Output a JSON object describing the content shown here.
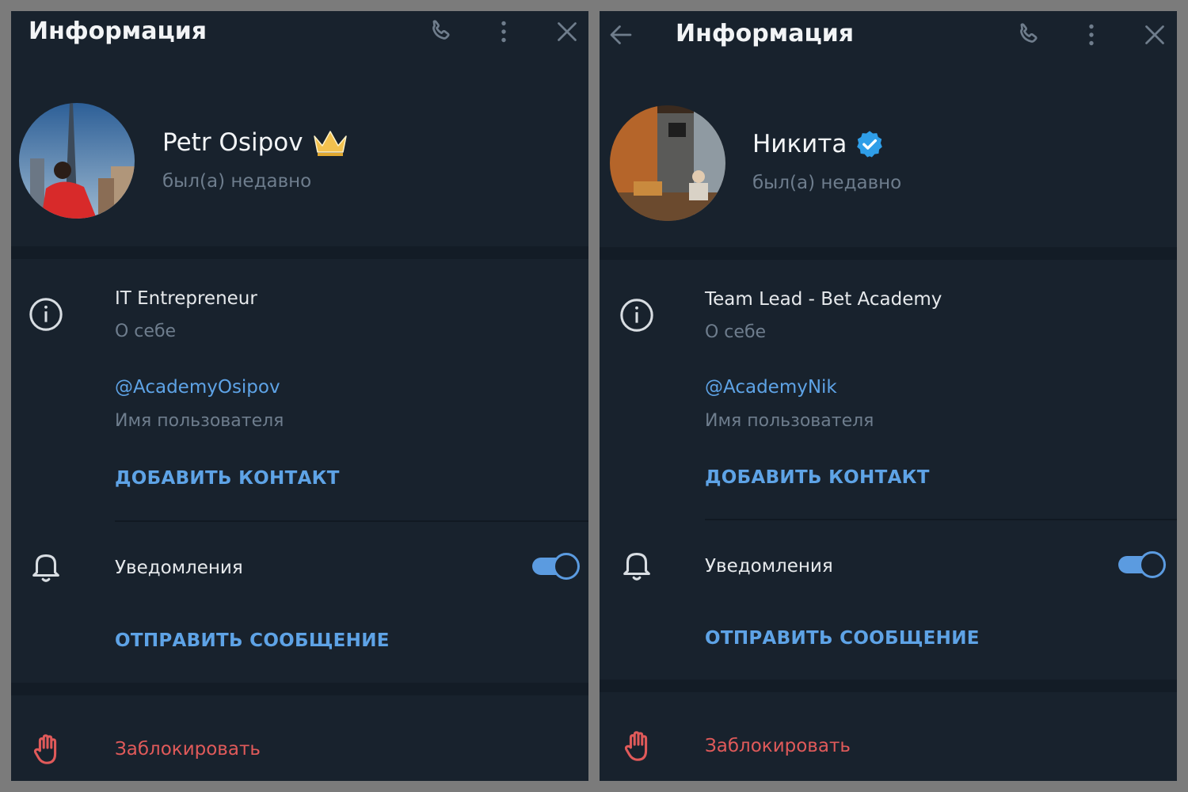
{
  "colors": {
    "accent": "#5ea3e6",
    "danger": "#e05a5a",
    "panel_bg": "#18222d",
    "verified": "#2f9ee8",
    "crown": "#f2c14e"
  },
  "panels": [
    {
      "title": "Информация",
      "name": "Petr Osipov",
      "name_badge": "crown-icon",
      "status": "был(а) недавно",
      "bio": "IT Entrepreneur",
      "bio_label": "О себе",
      "username": "@AcademyOsipov",
      "username_label": "Имя пользователя",
      "add_contact": "ДОБАВИТЬ КОНТАКТ",
      "notifications": "Уведомления",
      "notifications_on": true,
      "send_message": "ОТПРАВИТЬ СООБЩЕНИЕ",
      "block": "Заблокировать"
    },
    {
      "title": "Информация",
      "name": "Никита",
      "name_badge": "verified-badge-icon",
      "status": "был(а) недавно",
      "bio": "Team Lead - Bet Academy",
      "bio_label": "О себе",
      "username": "@AcademyNik",
      "username_label": "Имя пользователя",
      "add_contact": "ДОБАВИТЬ КОНТАКТ",
      "notifications": "Уведомления",
      "notifications_on": true,
      "send_message": "ОТПРАВИТЬ СООБЩЕНИЕ",
      "block": "Заблокировать"
    }
  ]
}
